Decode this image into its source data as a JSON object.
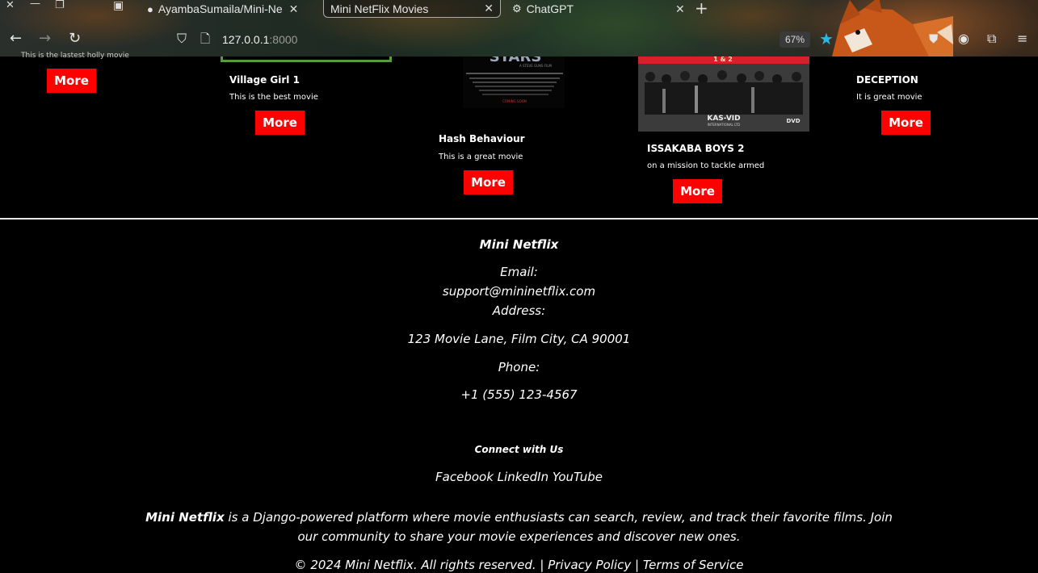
{
  "browser": {
    "tabs": [
      {
        "label": "AyambaSumaila/Mini-Ne",
        "icon": "github-icon"
      },
      {
        "label": "Mini NetFlix Movies",
        "icon": null
      },
      {
        "label": "ChatGPT",
        "icon": "chatgpt-icon"
      }
    ],
    "url_host": "127.0.0.1",
    "url_port": ":8000",
    "zoom": "67%"
  },
  "movies": [
    {
      "title": "",
      "desc": "This is the lastest holly movie",
      "more": "More"
    },
    {
      "title": "Village Girl 1",
      "desc": "This is the best movie",
      "more": "More"
    },
    {
      "title": "Hash Behaviour",
      "desc": "This is a great movie",
      "more": "More"
    },
    {
      "title": "ISSAKABA BOYS 2",
      "desc": "on a mission to tackle armed",
      "more": "More"
    },
    {
      "title": "DECEPTION",
      "desc": "It is great movie",
      "more": "More"
    }
  ],
  "poster_texts": {
    "hash_title": "STARS",
    "hash_credit": "A STEVE GUNS FILM",
    "hash_coming": "COMING SOON",
    "issakaba_num": "1 & 2",
    "issakaba_logo": "KAS-VID",
    "issakaba_company": "INTERNATIONAL LTD",
    "issakaba_dvd": "DVD"
  },
  "footer": {
    "brand": "Mini Netflix",
    "email_label": "Email:",
    "email": "support@mininetflix.com",
    "address_label": "Address:",
    "address": "123 Movie Lane, Film City, CA 90001",
    "phone_label": "Phone:",
    "phone": "+1 (555) 123-4567",
    "connect": "Connect with Us",
    "social": [
      "Facebook",
      "LinkedIn",
      "YouTube"
    ],
    "about_brand": "Mini Netflix",
    "about_text_1": " is a Django-powered platform where movie enthusiasts can search, review, and track their favorite films. Join",
    "about_text_2": "our community to share your movie experiences and discover new ones.",
    "copyright": "© 2024 Mini Netflix. All rights reserved. |",
    "privacy": "Privacy Policy",
    "sep": "|",
    "terms": "Terms of Service"
  }
}
